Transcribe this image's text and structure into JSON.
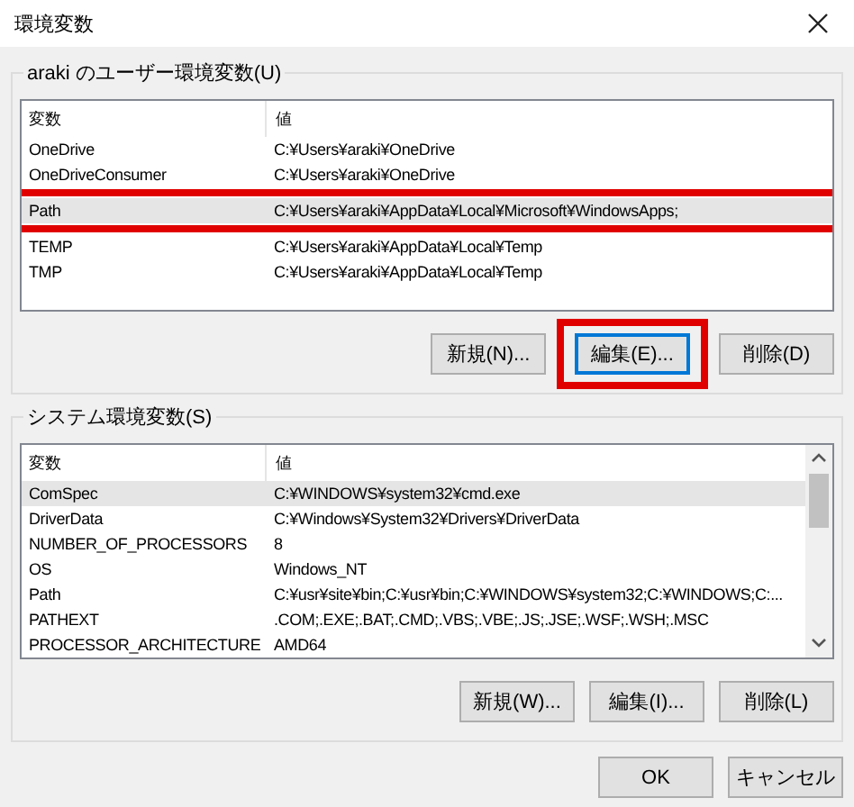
{
  "window": {
    "title": "環境変数"
  },
  "user_group": {
    "label": "araki のユーザー環境変数(U)",
    "columns": [
      "変数",
      "値"
    ],
    "rows": [
      {
        "name": "OneDrive",
        "value": "C:¥Users¥araki¥OneDrive",
        "selected": false,
        "highlighted": false
      },
      {
        "name": "OneDriveConsumer",
        "value": "C:¥Users¥araki¥OneDrive",
        "selected": false,
        "highlighted": false
      },
      {
        "name": "Path",
        "value": "C:¥Users¥araki¥AppData¥Local¥Microsoft¥WindowsApps;",
        "selected": true,
        "highlighted": true
      },
      {
        "name": "TEMP",
        "value": "C:¥Users¥araki¥AppData¥Local¥Temp",
        "selected": false,
        "highlighted": false
      },
      {
        "name": "TMP",
        "value": "C:¥Users¥araki¥AppData¥Local¥Temp",
        "selected": false,
        "highlighted": false
      }
    ],
    "buttons": [
      {
        "label": "新規(N)...",
        "focused": false,
        "highlighted": false
      },
      {
        "label": "編集(E)...",
        "focused": true,
        "highlighted": true
      },
      {
        "label": "削除(D)",
        "focused": false,
        "highlighted": false
      }
    ]
  },
  "system_group": {
    "label": "システム環境変数(S)",
    "columns": [
      "変数",
      "値"
    ],
    "rows": [
      {
        "name": "ComSpec",
        "value": "C:¥WINDOWS¥system32¥cmd.exe",
        "selected": true,
        "highlighted": false
      },
      {
        "name": "DriverData",
        "value": "C:¥Windows¥System32¥Drivers¥DriverData",
        "selected": false,
        "highlighted": false
      },
      {
        "name": "NUMBER_OF_PROCESSORS",
        "value": "8",
        "selected": false,
        "highlighted": false
      },
      {
        "name": "OS",
        "value": "Windows_NT",
        "selected": false,
        "highlighted": false
      },
      {
        "name": "Path",
        "value": "C:¥usr¥site¥bin;C:¥usr¥bin;C:¥WINDOWS¥system32;C:¥WINDOWS;C:...",
        "selected": false,
        "highlighted": false
      },
      {
        "name": "PATHEXT",
        "value": ".COM;.EXE;.BAT;.CMD;.VBS;.VBE;.JS;.JSE;.WSF;.WSH;.MSC",
        "selected": false,
        "highlighted": false
      },
      {
        "name": "PROCESSOR_ARCHITECTURE",
        "value": "AMD64",
        "selected": false,
        "highlighted": false
      }
    ],
    "buttons": [
      {
        "label": "新規(W)...",
        "focused": false,
        "highlighted": false
      },
      {
        "label": "編集(I)...",
        "focused": false,
        "highlighted": false
      },
      {
        "label": "削除(L)",
        "focused": false,
        "highlighted": false
      }
    ]
  },
  "dialog_buttons": [
    {
      "label": "OK",
      "focused": false,
      "highlighted": false
    },
    {
      "label": "キャンセル",
      "focused": false,
      "highlighted": false
    }
  ]
}
